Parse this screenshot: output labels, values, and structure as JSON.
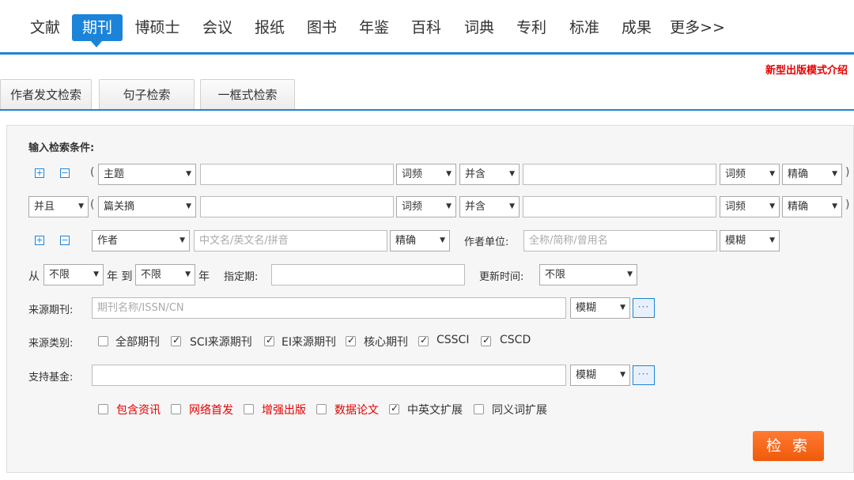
{
  "topnav": {
    "items": [
      "文献",
      "期刊",
      "博硕士",
      "会议",
      "报纸",
      "图书",
      "年鉴",
      "百科",
      "词典",
      "专利",
      "标准",
      "成果",
      "更多>>"
    ],
    "active_index": 1,
    "accent_color": "#1b84d8"
  },
  "new_mode_link": "新型出版模式介绍",
  "mode_tabs": [
    "作者发文检索",
    "句子检索",
    "一框式检索"
  ],
  "panel": {
    "heading": "输入检索条件:",
    "row1": {
      "paren_open": "(",
      "field": "主题",
      "freq1": "词频",
      "combine": "并含",
      "freq2": "词频",
      "match": "精确",
      "paren_close": ")"
    },
    "row2": {
      "logic": "并且",
      "paren_open": "(",
      "field": "篇关摘",
      "freq1": "词频",
      "combine": "并含",
      "freq2": "词频",
      "match": "精确",
      "paren_close": ")"
    },
    "row3": {
      "field": "作者",
      "author_placeholder": "中文名/英文名/拼音",
      "match": "精确",
      "unit_label": "作者单位:",
      "unit_placeholder": "全称/简称/曾用名",
      "unit_match": "模糊"
    },
    "row4": {
      "from_label": "从",
      "from_value": "不限",
      "year_to": "年 到",
      "to_value": "不限",
      "year": "年",
      "period_label": "指定期:",
      "update_label": "更新时间:",
      "update_value": "不限"
    },
    "row5": {
      "label": "来源期刊:",
      "placeholder": "期刊名称/ISSN/CN",
      "match": "模糊",
      "more": "···"
    },
    "row6": {
      "label": "来源类别:",
      "options": [
        {
          "text": "全部期刊",
          "checked": false
        },
        {
          "text": "SCI来源期刊",
          "checked": true
        },
        {
          "text": "EI来源期刊",
          "checked": true
        },
        {
          "text": "核心期刊",
          "checked": true
        },
        {
          "text": "CSSCI",
          "checked": true
        },
        {
          "text": "CSCD",
          "checked": true
        }
      ]
    },
    "row7": {
      "label": "支持基金:",
      "match": "模糊",
      "more": "···"
    },
    "row8": {
      "options": [
        {
          "text": "包含资讯",
          "checked": false,
          "color": "#e60000"
        },
        {
          "text": "网络首发",
          "checked": false,
          "color": "#e60000"
        },
        {
          "text": "增强出版",
          "checked": false,
          "color": "#e60000"
        },
        {
          "text": "数据论文",
          "checked": false,
          "color": "#e60000"
        },
        {
          "text": "中英文扩展",
          "checked": true,
          "color": "#333333"
        },
        {
          "text": "同义词扩展",
          "checked": false,
          "color": "#333333"
        }
      ]
    },
    "search_button": "检 索",
    "search_button_color": "#f05a0a"
  }
}
